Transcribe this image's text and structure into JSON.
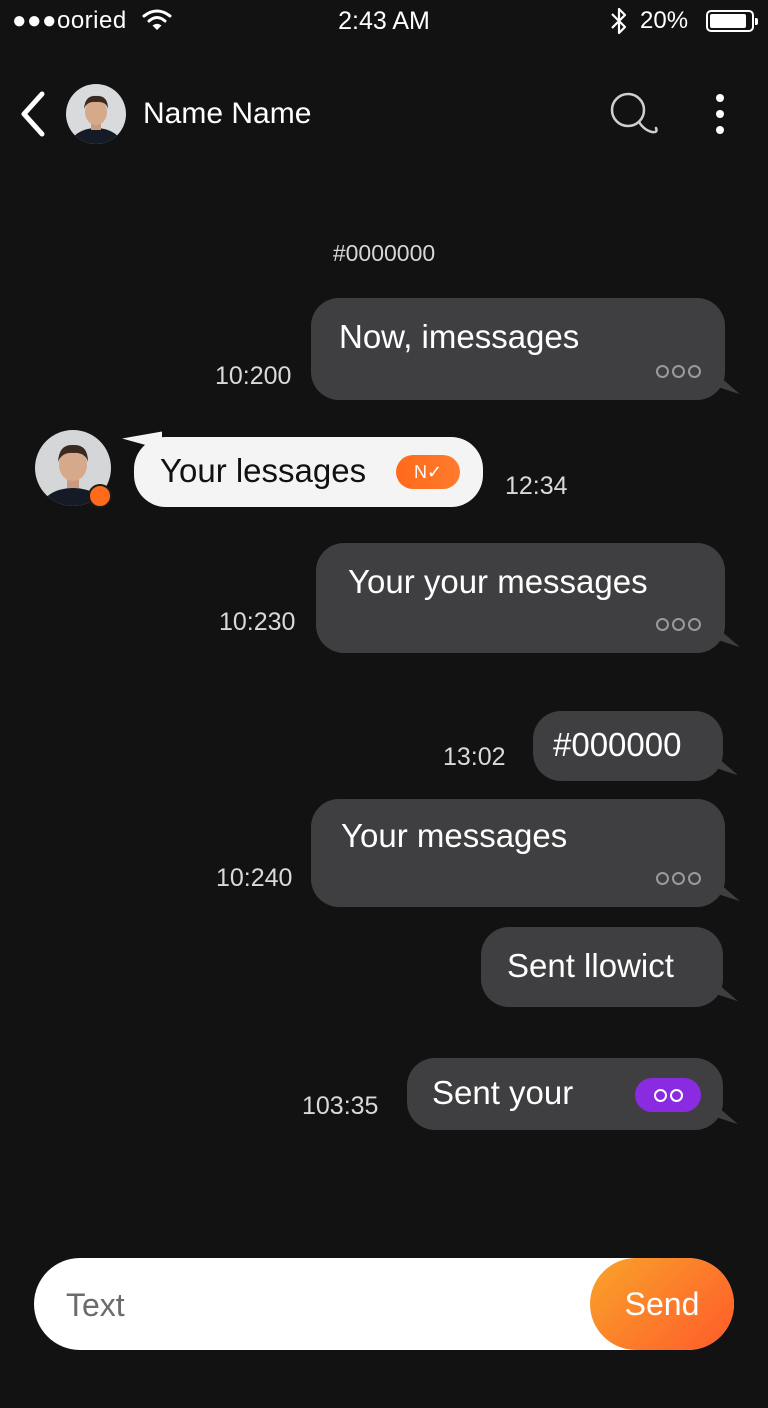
{
  "status_bar": {
    "carrier": "●●●oоried",
    "time": "2:43 AM",
    "battery_percent": "20%",
    "battery_level": 0.9
  },
  "header": {
    "contact_name": "Name Name",
    "icons": [
      "back-chevron-icon",
      "search-icon",
      "more-vertical-icon"
    ]
  },
  "thread": {
    "date_label": "#0000000",
    "messages": [
      {
        "direction": "outgoing",
        "text": "Now, imessages",
        "time": "10:200",
        "status": "ooo"
      },
      {
        "direction": "incoming",
        "text": "Your lessages",
        "time": "12:34",
        "badge": "N✓"
      },
      {
        "direction": "outgoing",
        "text": "Your your messages",
        "time": "10:230",
        "status": "ooo"
      },
      {
        "direction": "outgoing",
        "text": "#000000",
        "time": "13:02"
      },
      {
        "direction": "outgoing",
        "text": "Your messages",
        "time": "10:240",
        "status": "ooo"
      },
      {
        "direction": "outgoing",
        "text": "Sent llowict"
      },
      {
        "direction": "outgoing",
        "text": "Sent your",
        "time": "103:35",
        "badge": "oo"
      }
    ]
  },
  "composer": {
    "placeholder": "Text",
    "send_label": "Send"
  },
  "colors": {
    "background": "#121212",
    "outgoing_bubble": "#3f3f41",
    "incoming_bubble": "#f4f4f4",
    "accent_orange": "#ff6a1a",
    "accent_purple": "#8a2be2"
  }
}
